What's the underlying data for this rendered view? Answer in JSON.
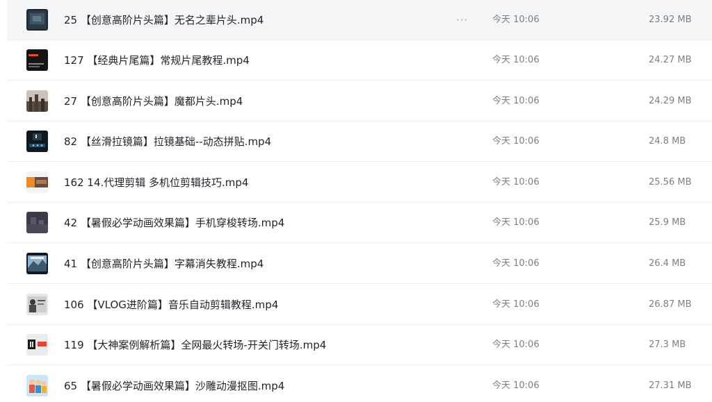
{
  "more_glyph": "···",
  "files": [
    {
      "name": "25 【创意高阶片头篇】无名之辈片头.mp4",
      "modified": "今天 10:06",
      "size": "23.92 MB",
      "thumb_icon": "dark-scene-thumbnail"
    },
    {
      "name": "127 【经典片尾篇】常规片尾教程.mp4",
      "modified": "今天 10:06",
      "size": "24.27 MB",
      "thumb_icon": "dark-title-thumbnail"
    },
    {
      "name": "27 【创意高阶片头篇】魔都片头.mp4",
      "modified": "今天 10:06",
      "size": "24.29 MB",
      "thumb_icon": "city-thumbnail"
    },
    {
      "name": "82 【丝滑拉镜篇】拉镜基础--动态拼贴.mp4",
      "modified": "今天 10:06",
      "size": "24.8 MB",
      "thumb_icon": "collage-thumbnail"
    },
    {
      "name": "162 14.代理剪辑 多机位剪辑技巧.mp4",
      "modified": "今天 10:06",
      "size": "25.56 MB",
      "thumb_icon": "orange-editor-thumbnail"
    },
    {
      "name": "42 【暑假必学动画效果篇】手机穿梭转场.mp4",
      "modified": "今天 10:06",
      "size": "25.9 MB",
      "thumb_icon": "night-thumbnail"
    },
    {
      "name": "41 【创意高阶片头篇】字幕消失教程.mp4",
      "modified": "今天 10:06",
      "size": "26.4 MB",
      "thumb_icon": "landscape-thumbnail"
    },
    {
      "name": "106 【VLOG进阶篇】音乐自动剪辑教程.mp4",
      "modified": "今天 10:06",
      "size": "26.87 MB",
      "thumb_icon": "person-thumbnail"
    },
    {
      "name": "119 【大神案例解析篇】全网最火转场-开关门转场.mp4",
      "modified": "今天 10:06",
      "size": "27.3 MB",
      "thumb_icon": "door-thumbnail"
    },
    {
      "name": "65 【暑假必学动画效果篇】沙雕动漫抠图.mp4",
      "modified": "今天 10:06",
      "size": "27.31 MB",
      "thumb_icon": "cartoon-thumbnail"
    }
  ]
}
